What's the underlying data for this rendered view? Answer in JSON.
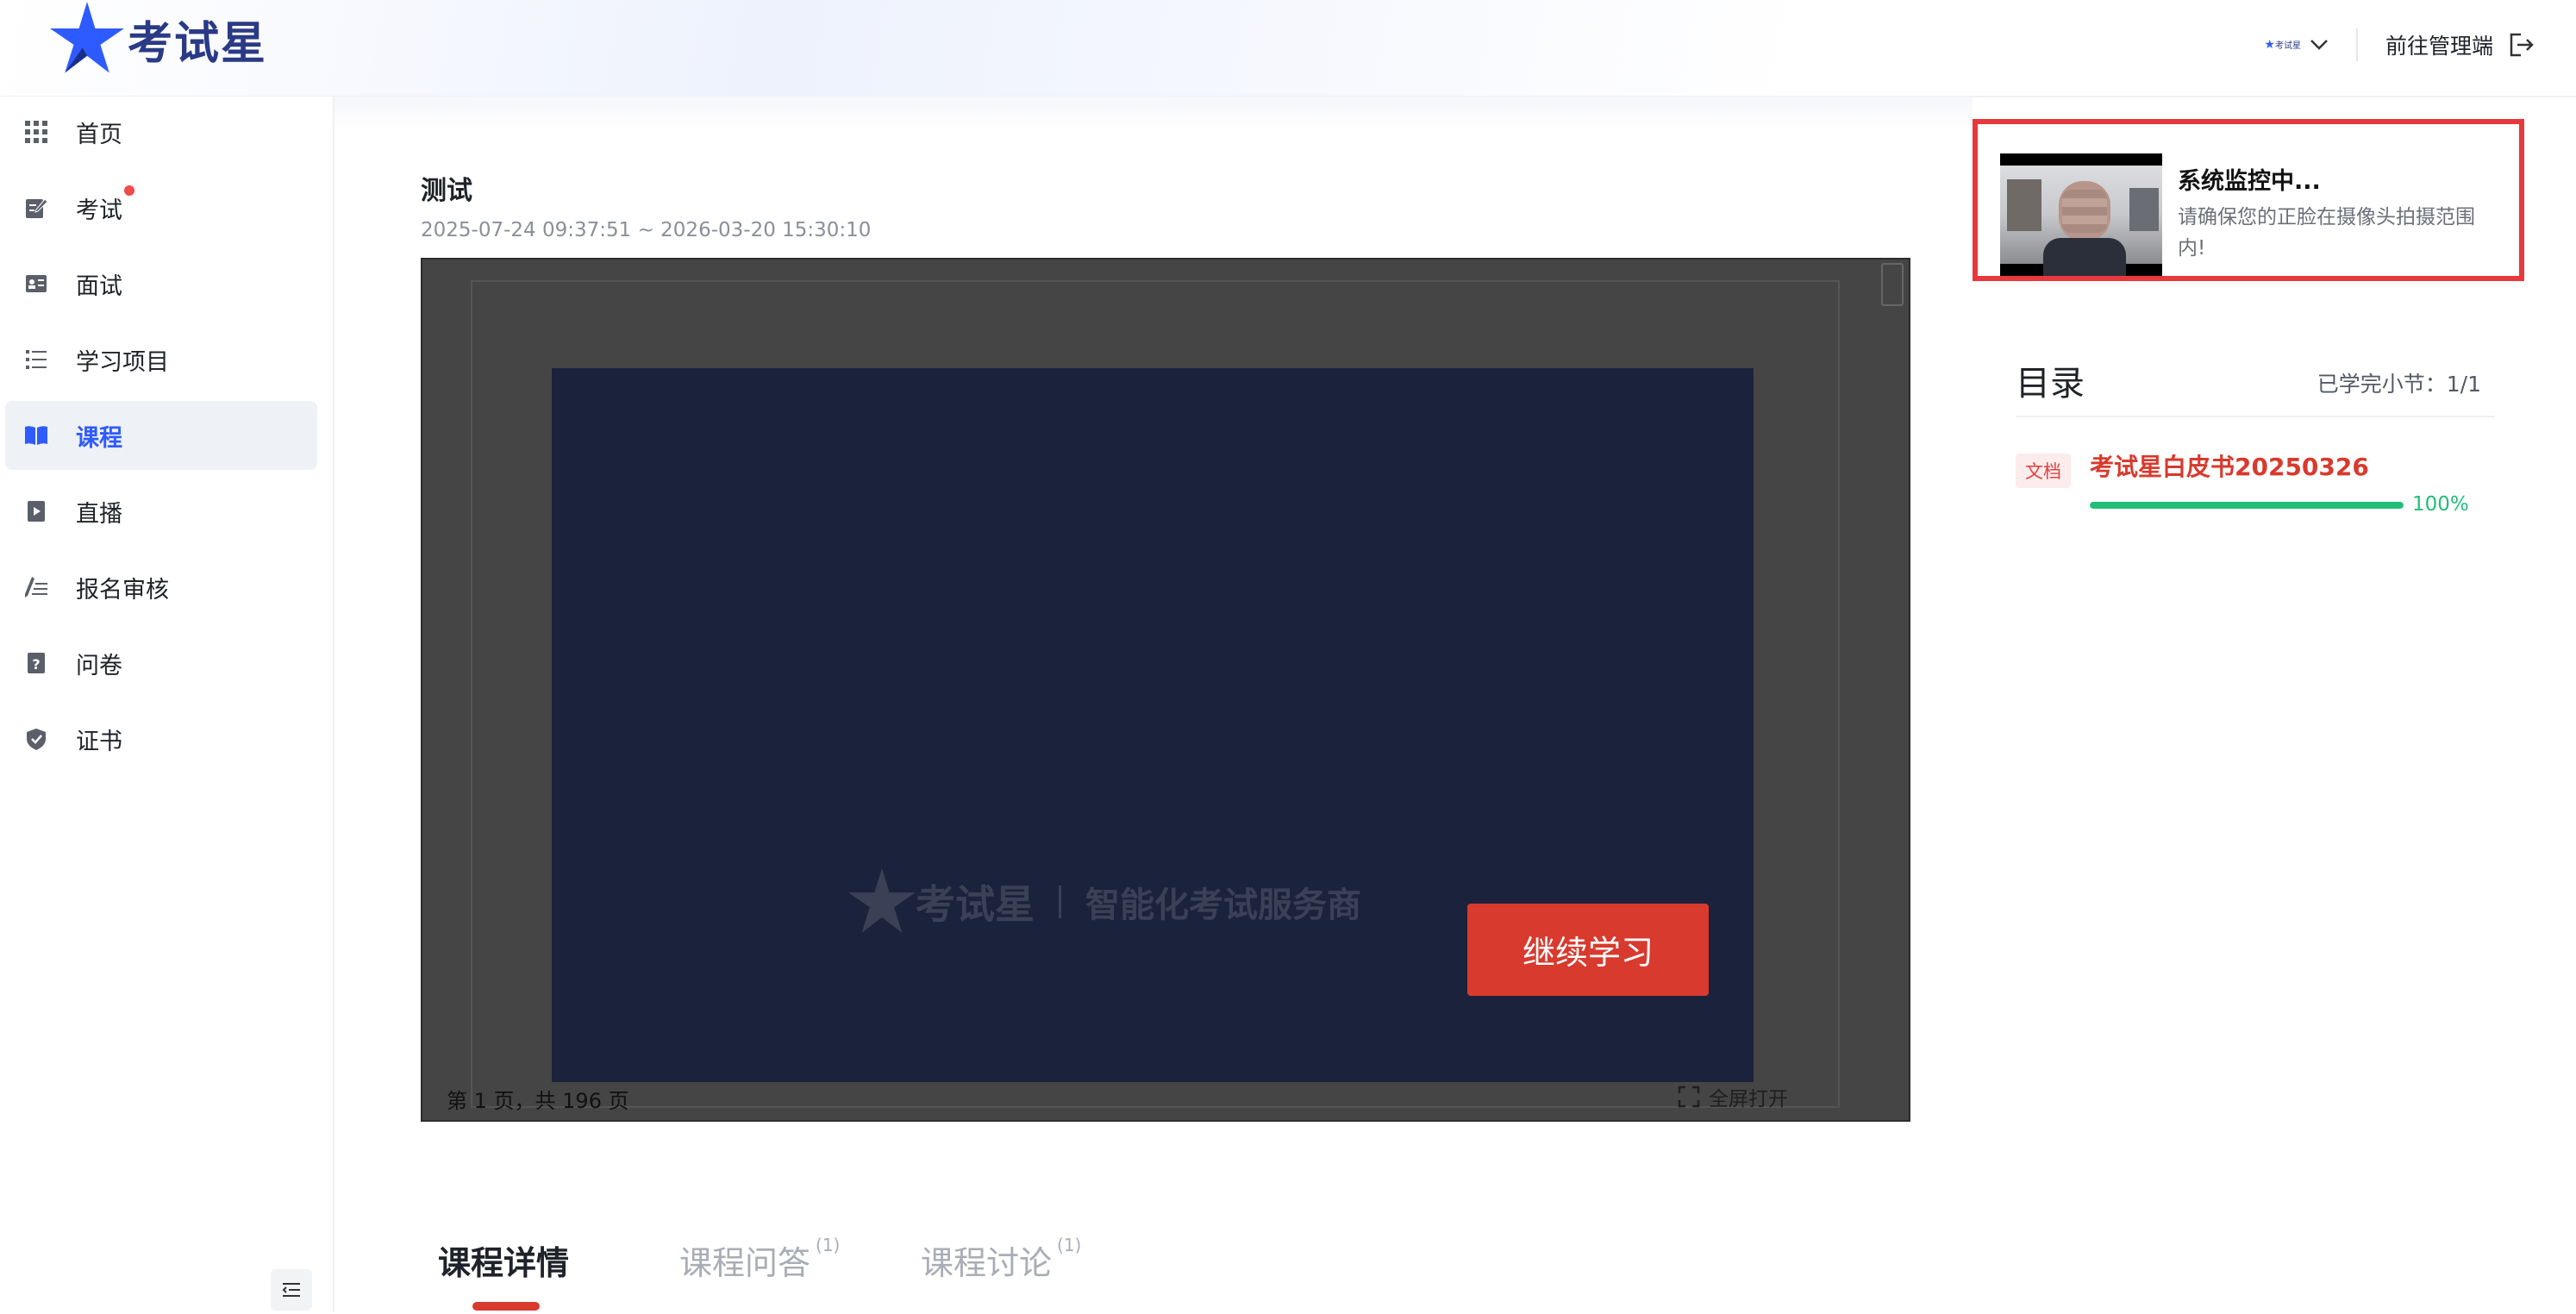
{
  "header": {
    "logo_text": "考试星",
    "org_switch_logo": "考试星",
    "admin_link": "前往管理端",
    "admin_icon": "logout-icon"
  },
  "sidebar": {
    "items": [
      {
        "label": "首页",
        "icon": "grid-icon"
      },
      {
        "label": "考试",
        "icon": "exam-edit-icon",
        "badge": true
      },
      {
        "label": "面试",
        "icon": "interview-card-icon"
      },
      {
        "label": "学习项目",
        "icon": "list-icon"
      },
      {
        "label": "课程",
        "icon": "book-icon",
        "active": true
      },
      {
        "label": "直播",
        "icon": "live-play-icon"
      },
      {
        "label": "报名审核",
        "icon": "signup-review-icon"
      },
      {
        "label": "问卷",
        "icon": "questionnaire-icon"
      },
      {
        "label": "证书",
        "icon": "shield-certificate-icon"
      }
    ],
    "collapse_icon": "collapse-menu-icon"
  },
  "course": {
    "title": "测试",
    "date_range": "2025-07-24 09:37:51 ~ 2026-03-20 15:30:10"
  },
  "viewer": {
    "watermark_brand": "考试星",
    "watermark_slogan": "智能化考试服务商",
    "continue_button": "继续学习",
    "page_info": "第 1 页，共 196 页",
    "fullscreen_label": "全屏打开"
  },
  "tabs": [
    {
      "label": "课程详情",
      "active": true
    },
    {
      "label": "课程问答",
      "count": "(1)"
    },
    {
      "label": "课程讨论",
      "count": "(1)"
    }
  ],
  "monitor": {
    "title": "系统监控中...",
    "description": "请确保您的正脸在摄像头拍摄范围内!"
  },
  "toc": {
    "title": "目录",
    "progress_label": "已学完小节：1/1",
    "items": [
      {
        "tag": "文档",
        "title": "考试星白皮书20250326",
        "progress": 100,
        "progress_text": "100%"
      }
    ]
  },
  "colors": {
    "brand_blue": "#2e5bff",
    "accent_red": "#d83a2e",
    "progress_green": "#22bd79",
    "monitor_border": "#e8383d"
  }
}
